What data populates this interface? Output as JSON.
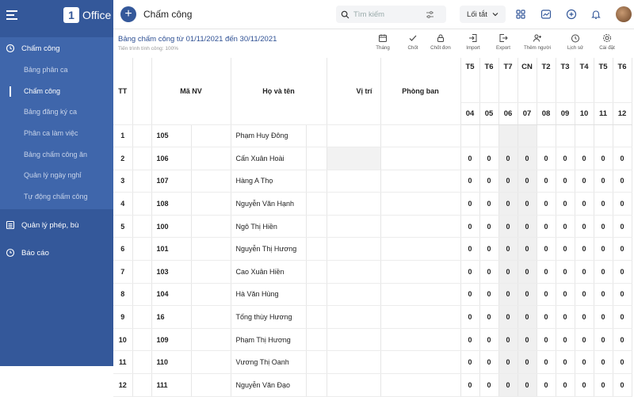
{
  "app": {
    "logo_text": "Office",
    "logo_letter": "1"
  },
  "sidebar": {
    "menu_title": "Chấm công",
    "items": [
      {
        "label": "Bảng phân ca",
        "active": false
      },
      {
        "label": "Chấm công",
        "active": true
      },
      {
        "label": "Bảng đăng ký ca",
        "active": false
      },
      {
        "label": "Phân ca làm việc",
        "active": false
      },
      {
        "label": "Bảng chấm công ăn",
        "active": false
      },
      {
        "label": "Quản lý ngày nghỉ",
        "active": false
      },
      {
        "label": "Tự động chấm công",
        "active": false
      }
    ],
    "section_leave": "Quản lý phép, bù",
    "section_report": "Báo cáo"
  },
  "topbar": {
    "title": "Chấm công",
    "search_placeholder": "Tìm kiếm",
    "filter_label": "Lối tắt"
  },
  "sheet": {
    "title": "Bảng chấm công từ 01/11/2021 đến 30/11/2021",
    "subtitle": "Tiến trình tính công: 100%"
  },
  "toolbar": [
    {
      "label": "Tháng",
      "icon": "calendar-icon"
    },
    {
      "label": "Chốt",
      "icon": "check-icon"
    },
    {
      "label": "Chốt đơn",
      "icon": "lock-icon"
    },
    {
      "label": "Import",
      "icon": "import-icon"
    },
    {
      "label": "Export",
      "icon": "export-icon"
    },
    {
      "label": "Thêm người",
      "icon": "add-person-icon"
    },
    {
      "label": "Lịch sử",
      "icon": "history-icon"
    },
    {
      "label": "Cài đặt",
      "icon": "settings-icon"
    }
  ],
  "table": {
    "headers": {
      "tt": "TT",
      "ma": "Mã NV",
      "name": "Họ và tên",
      "position": "Vị trí",
      "dept": "Phòng ban"
    },
    "weekdays": [
      "T5",
      "T6",
      "T7",
      "CN",
      "T2",
      "T3",
      "T4",
      "T5",
      "T6"
    ],
    "dates": [
      "04",
      "05",
      "06",
      "07",
      "08",
      "09",
      "10",
      "11",
      "12"
    ],
    "rows": [
      {
        "tt": "1",
        "ma": "105",
        "name": "Phạm Huy Đông",
        "days": [
          "",
          "",
          "",
          "",
          "",
          "",
          "",
          "",
          ""
        ]
      },
      {
        "tt": "2",
        "ma": "106",
        "name": "Cấn Xuân Hoài",
        "days": [
          "0",
          "0",
          "0",
          "0",
          "0",
          "0",
          "0",
          "0",
          "0"
        ]
      },
      {
        "tt": "3",
        "ma": "107",
        "name": "Hàng A Thọ",
        "days": [
          "0",
          "0",
          "0",
          "0",
          "0",
          "0",
          "0",
          "0",
          "0"
        ]
      },
      {
        "tt": "4",
        "ma": "108",
        "name": "Nguyễn Văn Hạnh",
        "days": [
          "0",
          "0",
          "0",
          "0",
          "0",
          "0",
          "0",
          "0",
          "0"
        ]
      },
      {
        "tt": "5",
        "ma": "100",
        "name": "Ngô Thị Hiền",
        "days": [
          "0",
          "0",
          "0",
          "0",
          "0",
          "0",
          "0",
          "0",
          "0"
        ]
      },
      {
        "tt": "6",
        "ma": "101",
        "name": "Nguyễn Thị Hương",
        "days": [
          "0",
          "0",
          "0",
          "0",
          "0",
          "0",
          "0",
          "0",
          "0"
        ]
      },
      {
        "tt": "7",
        "ma": "103",
        "name": "Cao Xuân Hiền",
        "days": [
          "0",
          "0",
          "0",
          "0",
          "0",
          "0",
          "0",
          "0",
          "0"
        ]
      },
      {
        "tt": "8",
        "ma": "104",
        "name": "Hà Văn Hùng",
        "days": [
          "0",
          "0",
          "0",
          "0",
          "0",
          "0",
          "0",
          "0",
          "0"
        ]
      },
      {
        "tt": "9",
        "ma": "16",
        "name": "Tống thùy Hương",
        "days": [
          "0",
          "0",
          "0",
          "0",
          "0",
          "0",
          "0",
          "0",
          "0"
        ]
      },
      {
        "tt": "10",
        "ma": "109",
        "name": "Phạm Thị Hương",
        "days": [
          "0",
          "0",
          "0",
          "0",
          "0",
          "0",
          "0",
          "0",
          "0"
        ]
      },
      {
        "tt": "11",
        "ma": "110",
        "name": "Vương Thị Oanh",
        "days": [
          "0",
          "0",
          "0",
          "0",
          "0",
          "0",
          "0",
          "0",
          "0"
        ]
      },
      {
        "tt": "12",
        "ma": "111",
        "name": "Nguyễn Văn Đạo",
        "days": [
          "0",
          "0",
          "0",
          "0",
          "0",
          "0",
          "0",
          "0",
          "0"
        ]
      }
    ]
  }
}
